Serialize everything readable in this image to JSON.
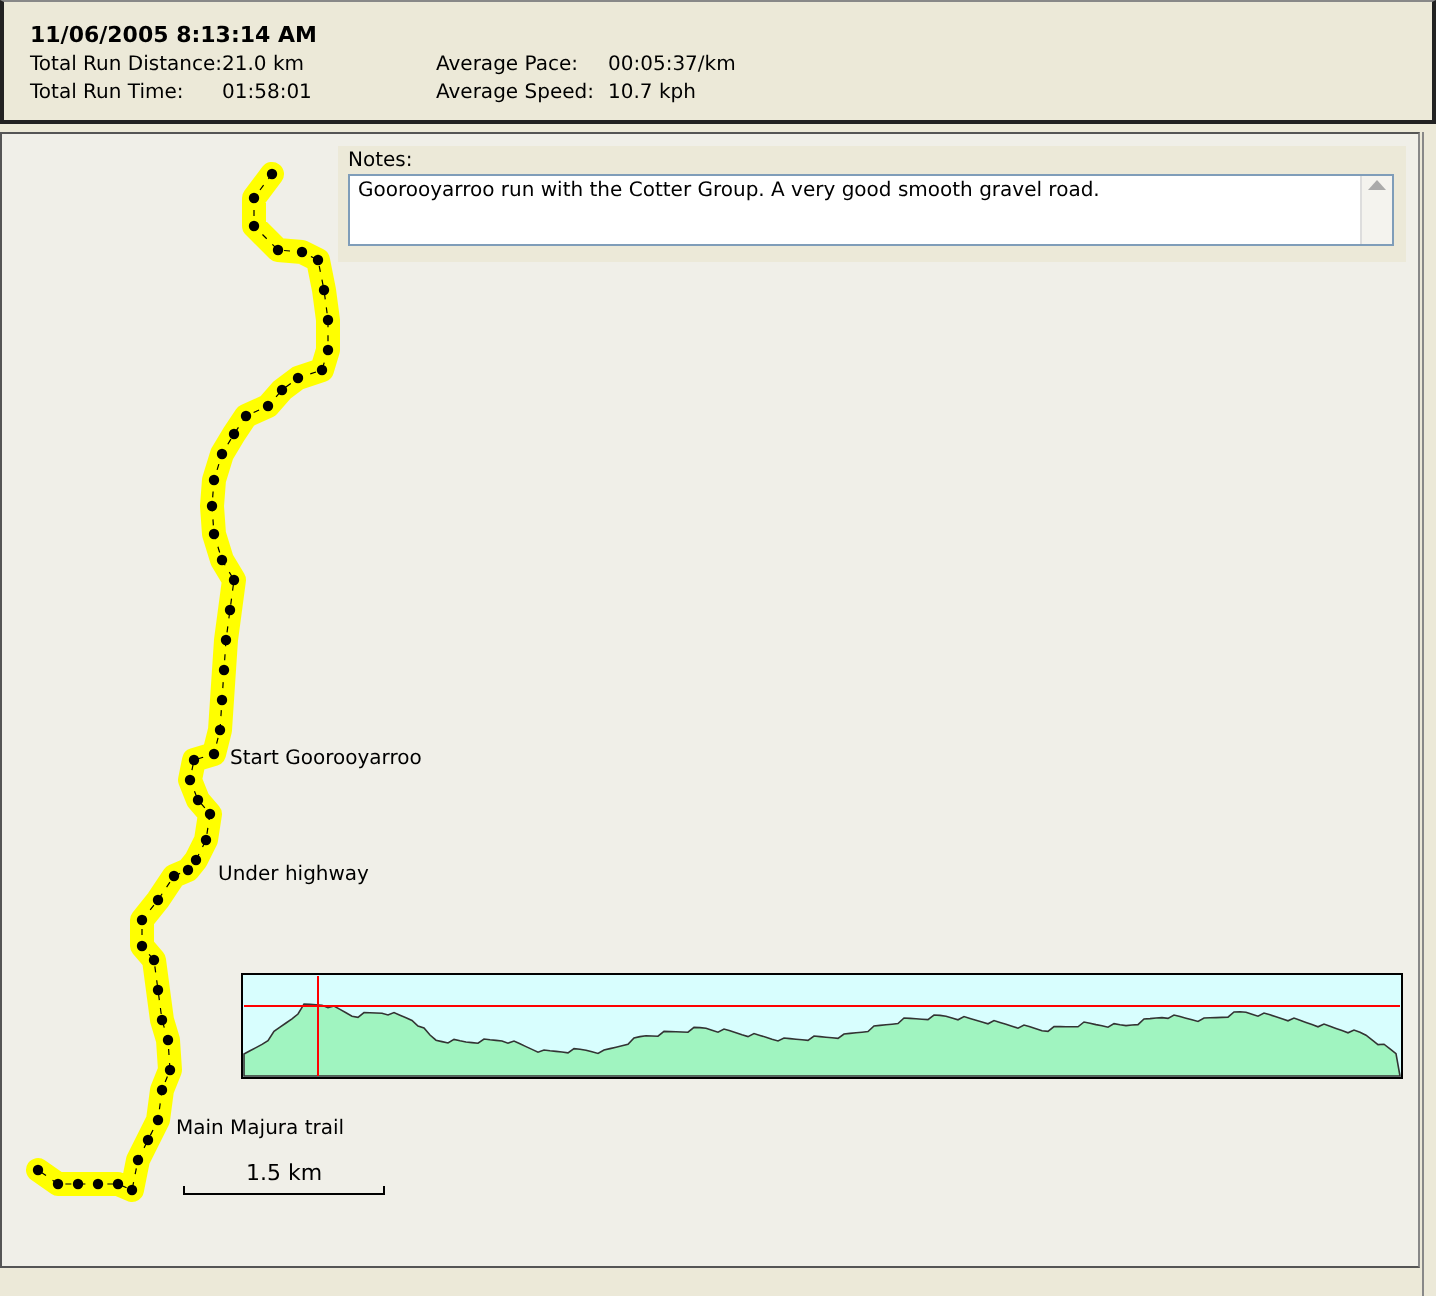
{
  "header": {
    "title": "11/06/2005  8:13:14 AM",
    "stats": [
      {
        "label": "Total Run Distance:",
        "value": "21.0 km"
      },
      {
        "label": "Average Pace:",
        "value": "00:05:37/km"
      },
      {
        "label": "Total Run Time:",
        "value": "01:58:01"
      },
      {
        "label": "Average Speed:",
        "value": "10.7 kph"
      }
    ]
  },
  "notes": {
    "label": "Notes:",
    "text": "Goorooyarroo run with the Cotter Group. A very good smooth gravel road."
  },
  "map": {
    "labels": [
      "Start Goorooyarroo",
      "Under highway",
      "Main Majura trail"
    ],
    "scale": "1.5 km"
  }
}
